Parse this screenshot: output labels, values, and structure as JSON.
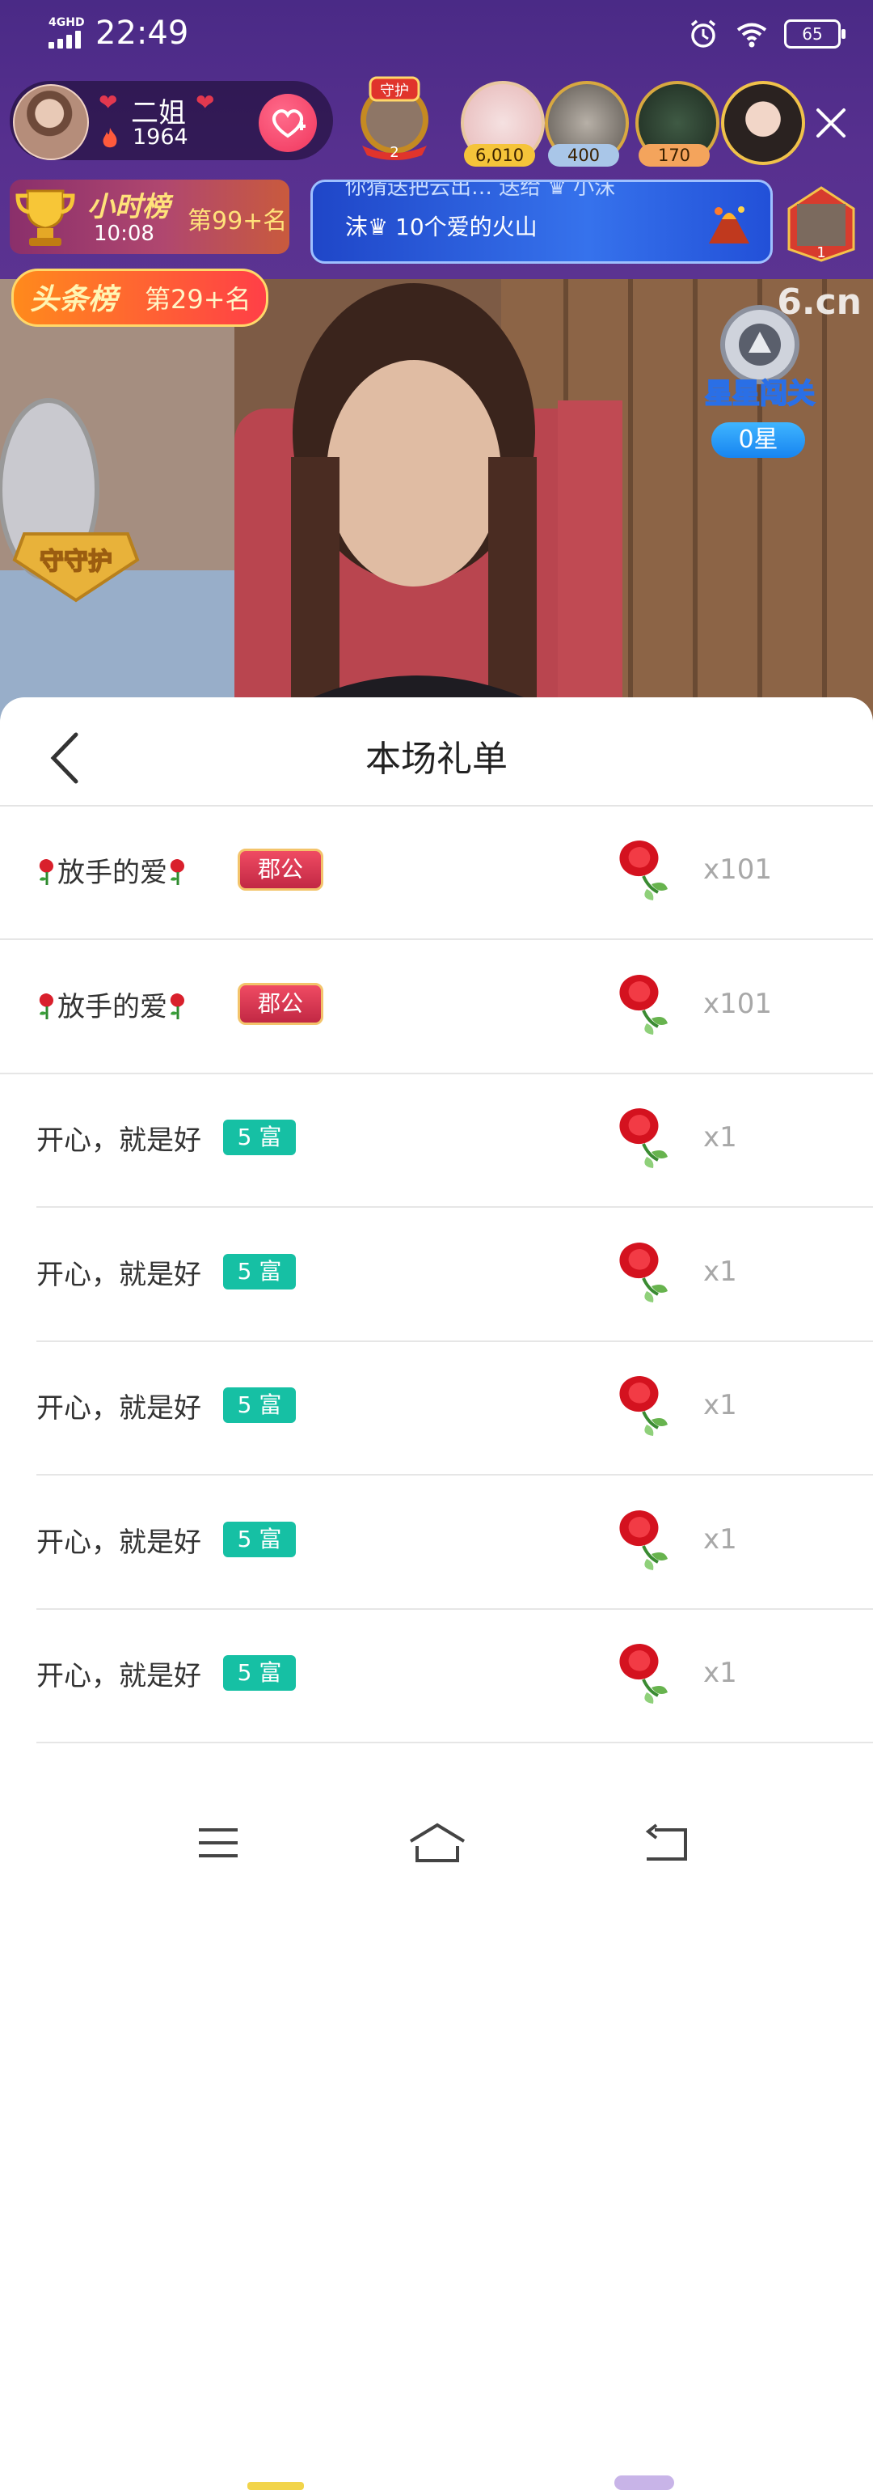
{
  "status_bar": {
    "network": "4GHD",
    "time": "22:49",
    "battery": "65"
  },
  "streamer": {
    "name": "二姐",
    "fire_count": "1964"
  },
  "guard": {
    "label": "守护",
    "count": "2"
  },
  "viewers": [
    {
      "count": "6,010",
      "pill_color": "#f5c43a"
    },
    {
      "count": "400",
      "pill_color": "#a9c6e8"
    },
    {
      "count": "170",
      "pill_color": "#f4a45c"
    }
  ],
  "hour_rank": {
    "title": "小时榜",
    "time": "10:08",
    "rank": "第99+名"
  },
  "broadcast": {
    "line1": "你猜送把云出… 送给 ♛ 小沫",
    "line2": "沫♛ 10个爱的火山"
  },
  "mini_avatar_count": "1",
  "headline_rank": {
    "title": "头条榜",
    "rank": "第29+名"
  },
  "video": {
    "logo": "6.cn",
    "star_game_title": "星星闯关",
    "star_count": "0星",
    "guard_shield_label": "守守护"
  },
  "sheet": {
    "title": "本场礼单",
    "rows": [
      {
        "name": "放手的爱",
        "badge_type": "jun",
        "badge": "郡公",
        "count": "x101"
      },
      {
        "name": "放手的爱",
        "badge_type": "jun",
        "badge": "郡公",
        "count": "x101"
      },
      {
        "name": "开心，就是好",
        "badge_type": "fu",
        "badge": "5 富",
        "count": "x1"
      },
      {
        "name": "开心，就是好",
        "badge_type": "fu",
        "badge": "5 富",
        "count": "x1"
      },
      {
        "name": "开心，就是好",
        "badge_type": "fu",
        "badge": "5 富",
        "count": "x1"
      },
      {
        "name": "开心，就是好",
        "badge_type": "fu",
        "badge": "5 富",
        "count": "x1"
      },
      {
        "name": "开心，就是好",
        "badge_type": "fu",
        "badge": "5 富",
        "count": "x1"
      }
    ]
  },
  "nav": {
    "icons": [
      "menu-icon",
      "home-icon",
      "back-icon"
    ]
  }
}
